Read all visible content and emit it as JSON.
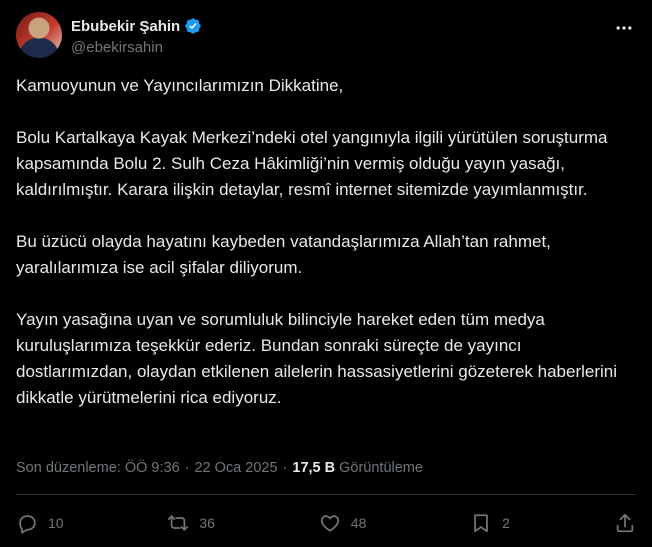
{
  "author": {
    "display_name": "Ebubekir Şahin",
    "handle": "@ebekirsahin",
    "verified_icon": "verified-badge-icon",
    "verified_color": "#1d9bf0"
  },
  "tweet": {
    "paragraphs": [
      "Kamuoyunun ve Yayıncılarımızın Dikkatine,",
      "Bolu Kartalkaya Kayak Merkezi’ndeki otel yangınıyla ilgili yürütülen soruşturma kapsamında Bolu 2. Sulh Ceza Hâkimliği’nin vermiş olduğu yayın yasağı, kaldırılmıştır. Karara ilişkin detaylar, resmî internet sitemizde yayımlanmıştır.",
      "Bu üzücü olayda hayatını kaybeden vatandaşlarımıza Allah’tan rahmet, yaralılarımıza ise acil şifalar diliyorum.",
      "Yayın yasağına uyan ve sorumluluk bilinciyle hareket eden tüm medya kuruluşlarımıza teşekkür ederiz. Bundan sonraki süreçte de yayıncı dostlarımızdan, olaydan etkilenen ailelerin hassasiyetlerini gözeterek haberlerini dikkatle yürütmelerini rica ediyoruz."
    ]
  },
  "meta": {
    "edited_label": "Son düzenleme:",
    "time": "ÖÖ 9:36",
    "date": "22 Oca 2025",
    "separator": "·",
    "views_count": "17,5 B",
    "views_label": "Görüntüleme"
  },
  "actions": {
    "replies": "10",
    "reposts": "36",
    "likes": "48",
    "bookmarks": "2"
  },
  "colors": {
    "background": "#000000",
    "text": "#e7e9ea",
    "muted": "#71767b",
    "divider": "#2f3336"
  }
}
